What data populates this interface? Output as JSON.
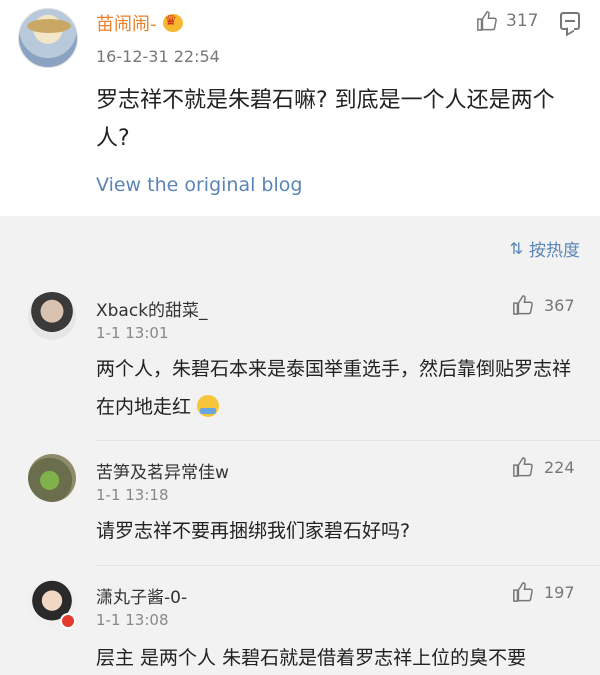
{
  "post": {
    "username": "苗闹闹-",
    "timestamp": "16-12-31 22:54",
    "likes": "317",
    "text": "罗志祥不就是朱碧石嘛? 到底是一个人还是两个人?",
    "view_original": "View the original blog",
    "icons": [
      "crown-badge-icon",
      "thumb-up-icon",
      "comment-icon"
    ]
  },
  "sort": {
    "label": "按热度",
    "icon": "sort-icon"
  },
  "comments": [
    {
      "username": "Xback的甜菜_",
      "time": "1-1 13:01",
      "likes": "367",
      "text": "两个人，朱碧石本来是泰国举重选手，然后靠倒贴罗志祥在内地走红"
    },
    {
      "username": "苦笋及茗异常佳w",
      "time": "1-1 13:18",
      "likes": "224",
      "text": "请罗志祥不要再捆绑我们家碧石好吗?"
    },
    {
      "username": "潇丸子酱-0-",
      "time": "1-1 13:08",
      "likes": "197",
      "text": "层主 是两个人 朱碧石就是借着罗志祥上位的臭不要"
    }
  ],
  "colors": {
    "username_orange": "#e9802a",
    "link_blue": "#5b85b6",
    "page_bg": "#f2f2f2"
  }
}
